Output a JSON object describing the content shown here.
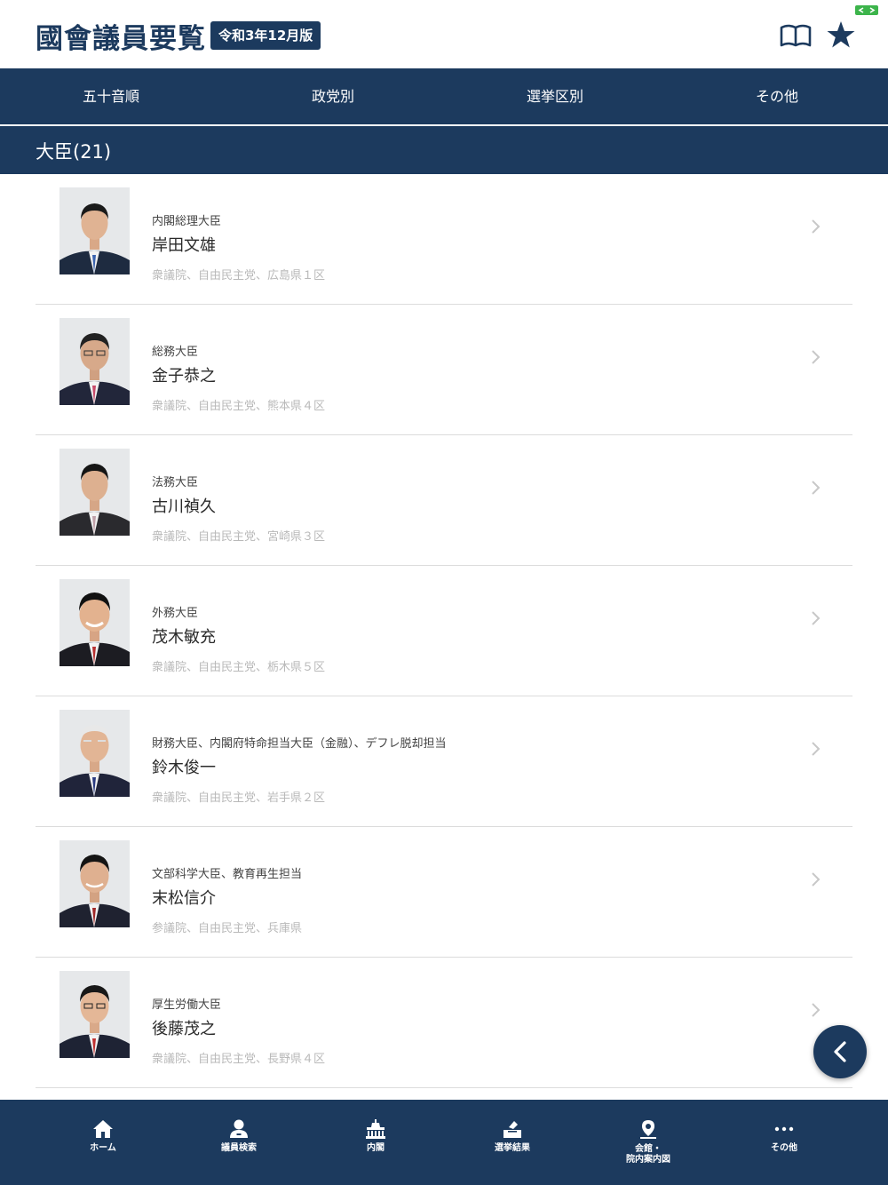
{
  "header": {
    "title": "國會議員要覧",
    "edition": "令和3年12月版"
  },
  "tabs": [
    {
      "label": "五十音順"
    },
    {
      "label": "政党別"
    },
    {
      "label": "選挙区別"
    },
    {
      "label": "その他"
    }
  ],
  "section": {
    "title": "大臣(21)"
  },
  "members": [
    {
      "role": "内閣総理大臣",
      "name": "岸田文雄",
      "detail": "衆議院、自由民主党、広島県１区"
    },
    {
      "role": "総務大臣",
      "name": "金子恭之",
      "detail": "衆議院、自由民主党、熊本県４区"
    },
    {
      "role": "法務大臣",
      "name": "古川禎久",
      "detail": "衆議院、自由民主党、宮崎県３区"
    },
    {
      "role": "外務大臣",
      "name": "茂木敏充",
      "detail": "衆議院、自由民主党、栃木県５区"
    },
    {
      "role": "財務大臣、内閣府特命担当大臣（金融）、デフレ脱却担当",
      "name": "鈴木俊一",
      "detail": "衆議院、自由民主党、岩手県２区"
    },
    {
      "role": "文部科学大臣、教育再生担当",
      "name": "末松信介",
      "detail": "参議院、自由民主党、兵庫県"
    },
    {
      "role": "厚生労働大臣",
      "name": "後藤茂之",
      "detail": "衆議院、自由民主党、長野県４区"
    }
  ],
  "bottom_nav": [
    {
      "label": "ホーム",
      "icon": "home-icon"
    },
    {
      "label": "議員検索",
      "icon": "member-search-icon"
    },
    {
      "label": "内閣",
      "icon": "cabinet-building-icon"
    },
    {
      "label": "選挙結果",
      "icon": "ballot-box-icon"
    },
    {
      "label": "会館・\n院内案内図",
      "icon": "map-pin-icon"
    },
    {
      "label": "その他",
      "icon": "more-dots-icon"
    }
  ],
  "colors": {
    "primary": "#1c3a5e",
    "detail_text": "#b9b9b9"
  }
}
